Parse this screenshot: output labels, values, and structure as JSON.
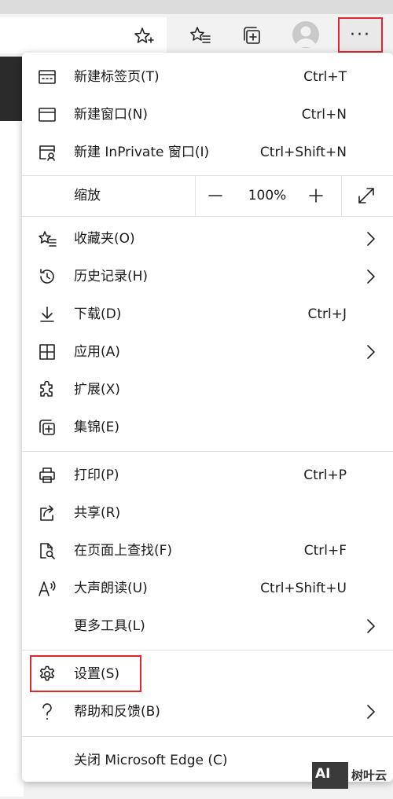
{
  "toolbar": {
    "icons": [
      "star-add-icon",
      "favorites-icon",
      "collections-icon",
      "profile-avatar-icon",
      "more-icon"
    ],
    "more_label": "···"
  },
  "menu": {
    "new_tab": {
      "label": "新建标签页(T)",
      "shortcut": "Ctrl+T",
      "icon": "new-tab-icon"
    },
    "new_window": {
      "label": "新建窗口(N)",
      "shortcut": "Ctrl+N",
      "icon": "new-window-icon"
    },
    "new_inprivate": {
      "label": "新建 InPrivate 窗口(I)",
      "shortcut": "Ctrl+Shift+N",
      "icon": "inprivate-icon"
    },
    "zoom": {
      "label": "缩放",
      "minus": "—",
      "value": "100%",
      "plus": "+",
      "icon": "fullscreen-icon"
    },
    "favorites": {
      "label": "收藏夹(O)",
      "icon": "favorites-icon"
    },
    "history": {
      "label": "历史记录(H)",
      "icon": "history-icon"
    },
    "downloads": {
      "label": "下载(D)",
      "shortcut": "Ctrl+J",
      "icon": "download-icon"
    },
    "apps": {
      "label": "应用(A)",
      "icon": "apps-icon"
    },
    "extensions": {
      "label": "扩展(X)",
      "icon": "extensions-icon"
    },
    "collections": {
      "label": "集锦(E)",
      "icon": "collections-icon"
    },
    "print": {
      "label": "打印(P)",
      "shortcut": "Ctrl+P",
      "icon": "print-icon"
    },
    "share": {
      "label": "共享(R)",
      "icon": "share-icon"
    },
    "find": {
      "label": "在页面上查找(F)",
      "shortcut": "Ctrl+F",
      "icon": "find-icon"
    },
    "read_aloud": {
      "label": "大声朗读(U)",
      "shortcut": "Ctrl+Shift+U",
      "icon": "read-aloud-icon"
    },
    "more_tools": {
      "label": "更多工具(L)"
    },
    "settings": {
      "label": "设置(S)",
      "icon": "gear-icon"
    },
    "help": {
      "label": "帮助和反馈(B)",
      "icon": "help-icon"
    },
    "close": {
      "label": "关闭 Microsoft Edge (C)"
    }
  },
  "watermark": {
    "logo": "AI",
    "text": "树叶云"
  },
  "colors": {
    "highlight": "#e0262e",
    "menu_bg": "#ffffff",
    "separator": "#e3e3e3"
  }
}
